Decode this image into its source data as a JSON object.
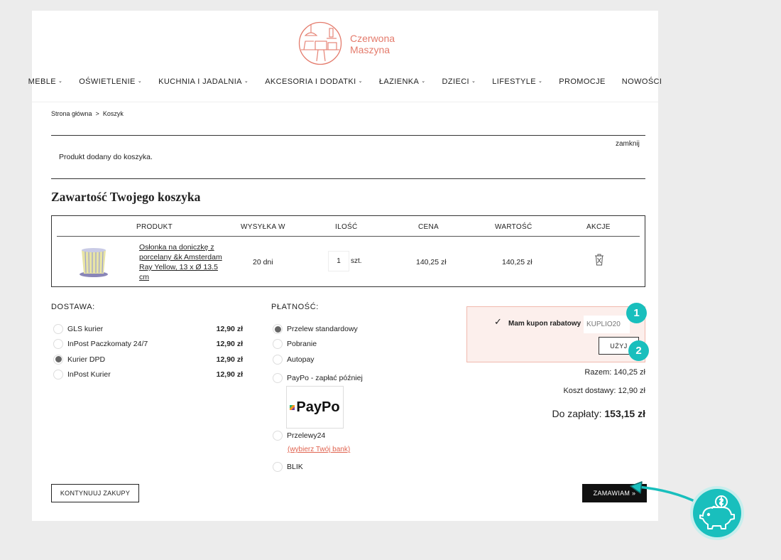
{
  "brand": {
    "line1": "Czerwona",
    "line2": "Maszyna",
    "color": "#e47b6c"
  },
  "nav": [
    {
      "label": "MEBLE",
      "chevron": true
    },
    {
      "label": "OŚWIETLENIE",
      "chevron": true
    },
    {
      "label": "KUCHNIA I JADALNIA",
      "chevron": true
    },
    {
      "label": "AKCESORIA I DODATKI",
      "chevron": true
    },
    {
      "label": "ŁAZIENKA",
      "chevron": true
    },
    {
      "label": "DZIECI",
      "chevron": true
    },
    {
      "label": "LIFESTYLE",
      "chevron": true
    },
    {
      "label": "PROMOCJE",
      "chevron": false
    },
    {
      "label": "NOWOŚCI",
      "chevron": false
    }
  ],
  "breadcrumb": {
    "home": "Strona główna",
    "separator": ">",
    "current": "Koszyk"
  },
  "notice": {
    "close": "zamknij",
    "message": "Produkt dodany do koszyka."
  },
  "cart": {
    "title": "Zawartość Twojego koszyka",
    "headers": {
      "product": "PRODUKT",
      "shipping": "WYSYŁKA W",
      "qty": "ILOŚĆ",
      "price": "CENA",
      "value": "WARTOŚĆ",
      "actions": "AKCJE"
    },
    "item": {
      "name": "Osłonka na doniczkę z porcelany &k Amsterdam Ray Yellow, 13 x Ø 13.5 cm",
      "shipping": "20 dni",
      "qty": "1",
      "unit": "szt.",
      "price": "140,25 zł",
      "value": "140,25 zł"
    }
  },
  "delivery": {
    "label": "DOSTAWA:",
    "options": [
      {
        "name": "GLS kurier",
        "price": "12,90 zł",
        "selected": false
      },
      {
        "name": "InPost Paczkomaty 24/7",
        "price": "12,90 zł",
        "selected": false
      },
      {
        "name": "Kurier DPD",
        "price": "12,90 zł",
        "selected": true
      },
      {
        "name": "InPost Kurier",
        "price": "12,90 zł",
        "selected": false
      }
    ]
  },
  "payment": {
    "label": "PŁATNOŚĆ:",
    "options": [
      {
        "name": "Przelew standardowy",
        "selected": true
      },
      {
        "name": "Pobranie",
        "selected": false
      },
      {
        "name": "Autopay",
        "selected": false
      },
      {
        "name": "PayPo - zapłać później",
        "selected": false
      },
      {
        "name": "Przelewy24",
        "selected": false
      },
      {
        "name": "BLIK",
        "selected": false
      }
    ],
    "paypo_logo": "PayPo",
    "bank_link": "(wybierz Twój bank)"
  },
  "coupon": {
    "label": "Mam kupon rabatowy",
    "checked": true,
    "value": "KUPLIO20",
    "apply_label": "UŻYJ",
    "badge1": "1",
    "badge2": "2",
    "accent": "#19bfbd"
  },
  "totals": {
    "subtotal": "Razem: 140,25 zł",
    "shipping": "Koszt dostawy: 12,90 zł",
    "due_label": "Do zapłaty:",
    "due_value": "153,15 zł"
  },
  "actions": {
    "continue": "KONTYNUUJ ZAKUPY",
    "order": "ZAMAWIAM »"
  }
}
